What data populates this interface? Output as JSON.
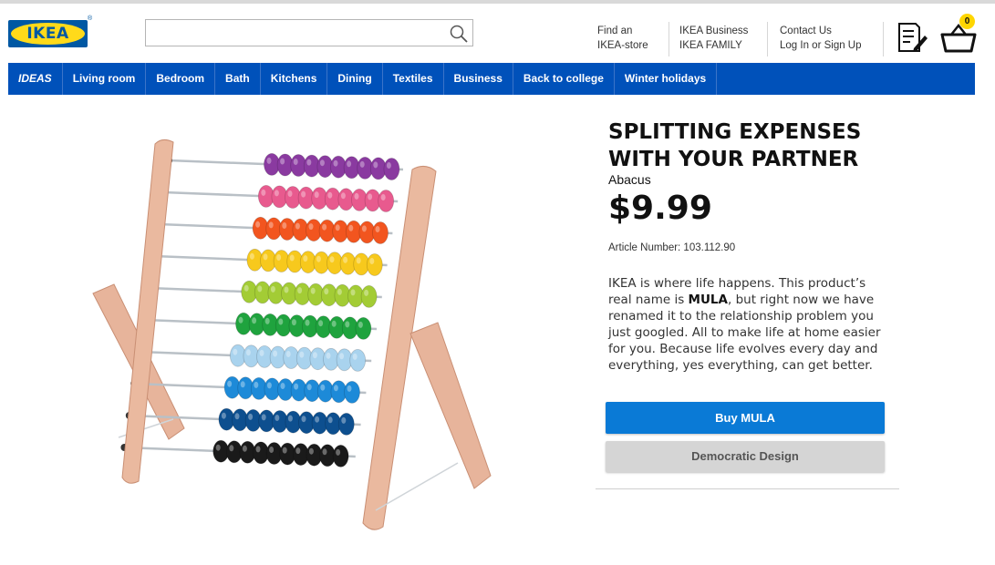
{
  "header": {
    "logo_text": "IKEA",
    "logo_reg": "®",
    "search": {
      "placeholder": "",
      "value": ""
    },
    "links": {
      "store_line1": "Find an",
      "store_line2": "IKEA-store",
      "business_line1": "IKEA Business",
      "business_line2": "IKEA FAMILY",
      "contact_line1": "Contact Us",
      "contact_line2": "Log In or Sign Up"
    },
    "cart_count": "0"
  },
  "nav": {
    "items": [
      "IDEAS",
      "Living room",
      "Bedroom",
      "Bath",
      "Kitchens",
      "Dining",
      "Textiles",
      "Business",
      "Back to college",
      "Winter holidays"
    ]
  },
  "product": {
    "title": "SPLITTING EXPENSES WITH YOUR PARTNER",
    "subtitle": "Abacus",
    "price": "$9.99",
    "article": "Article Number: 103.112.90",
    "desc_before": "IKEA is where life happens. This product’s real name is ",
    "desc_bold": "MULA",
    "desc_after": ", but right now we have renamed it to the relationship problem you just googled. All to make life at home easier for you. Because life evolves every day and everything, yes everything, can get better.",
    "buy_label": "Buy MULA",
    "design_label": "Democratic Design",
    "bead_colors": [
      "#8a3aa0",
      "#e85a8e",
      "#f2551f",
      "#f7c91d",
      "#a3cc35",
      "#1fa33e",
      "#a9d3ee",
      "#1d8ad8",
      "#0d4f8f",
      "#1a1a1a"
    ]
  },
  "colors": {
    "nav_bg": "#0051ba",
    "buy_button": "#0a7ad6",
    "brand_yellow": "#ffda1a",
    "brand_blue": "#0058a3"
  }
}
